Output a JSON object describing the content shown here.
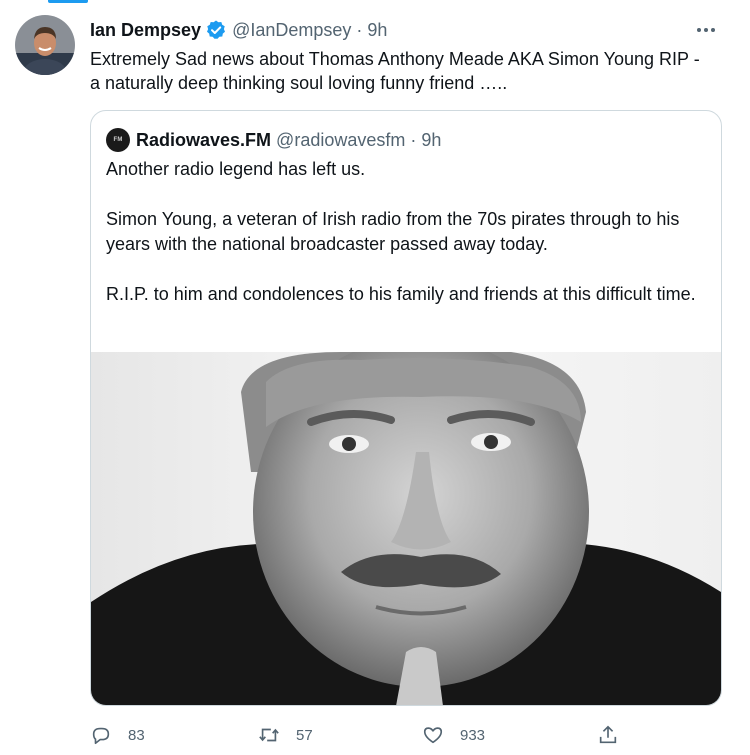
{
  "tweet": {
    "author": {
      "name": "Ian Dempsey",
      "handle": "@IanDempsey",
      "verified": true,
      "avatar": "profile-photo"
    },
    "separator": "·",
    "time": "9h",
    "text_lines": [
      "Extremely Sad news about Thomas Anthony Meade AKA Simon Young RIP -",
      "a naturally deep thinking soul loving funny friend ….."
    ],
    "more_icon": "ellipsis-icon"
  },
  "quoted_tweet": {
    "author": {
      "name": "Radiowaves.FM",
      "handle": "@radiowavesfm",
      "avatar": "radiowaves-logo"
    },
    "separator": "·",
    "time": "9h",
    "paragraphs": [
      "Another radio legend has left us.",
      "Simon Young, a veteran of Irish radio from the 70s pirates through to his years with the national broadcaster passed away today.",
      "R.I.P. to him and condolences to his family and friends at this difficult time."
    ],
    "image": "black-and-white-portrait-photo"
  },
  "actions": {
    "reply": {
      "icon": "reply-icon",
      "count": "83"
    },
    "retweet": {
      "icon": "retweet-icon",
      "count": "57"
    },
    "like": {
      "icon": "heart-icon",
      "count": "933"
    },
    "share": {
      "icon": "share-icon"
    }
  },
  "colors": {
    "accent": "#1d9bf0",
    "text": "#0f1419",
    "secondary": "#536471",
    "border": "#cfd9de"
  }
}
